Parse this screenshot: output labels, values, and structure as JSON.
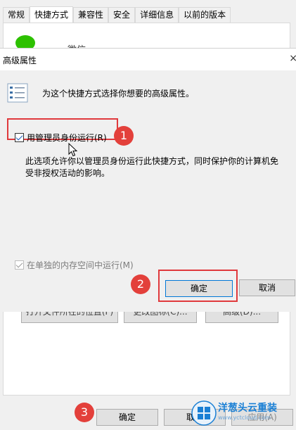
{
  "background_window": {
    "tabs": [
      {
        "label": "常规",
        "active": false
      },
      {
        "label": "快捷方式",
        "active": true
      },
      {
        "label": "兼容性",
        "active": false
      },
      {
        "label": "安全",
        "active": false
      },
      {
        "label": "详细信息",
        "active": false
      },
      {
        "label": "以前的版本",
        "active": false
      }
    ],
    "app_name_partial": "微信",
    "shortcut_buttons": [
      {
        "label": "打开文件所在的位置(F)"
      },
      {
        "label": "更改图标(C)..."
      },
      {
        "label": "高级(D)..."
      }
    ],
    "bottom_buttons": {
      "ok": "确定",
      "cancel": "取消",
      "apply": "应用(A)"
    }
  },
  "dialog": {
    "title": "高级属性",
    "close_glyph": "×",
    "intro": "为这个快捷方式选择你想要的高级属性。",
    "run_as_admin": {
      "label": "用管理员身份运行(R)",
      "checked": true
    },
    "description": "此选项允许你以管理员身份运行此快捷方式，同时保护你的计算机免受非授权活动的影响。",
    "run_in_separate_memory": {
      "label": "在单独的内存空间中运行(M)",
      "checked": true,
      "disabled": true
    },
    "ok_label": "确定",
    "cancel_label": "取消"
  },
  "annotations": {
    "step1": "1",
    "step2": "2",
    "step3": "3",
    "color": "#e3403b"
  },
  "watermark": {
    "text": "洋葱头云重装",
    "url": "www.yctcloud.com"
  }
}
